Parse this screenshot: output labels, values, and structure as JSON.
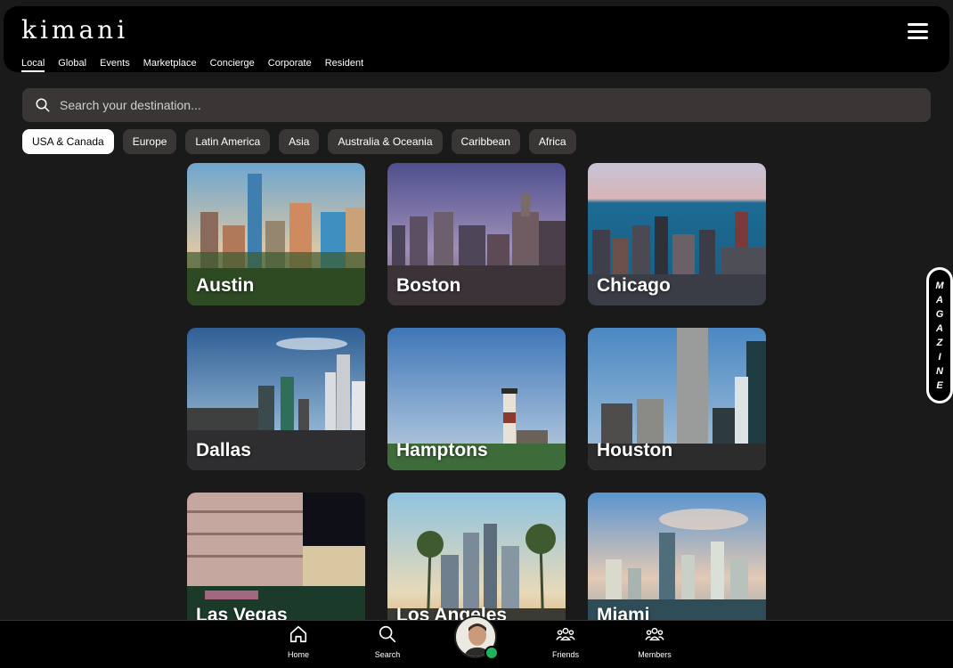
{
  "app": {
    "logo": "kimani"
  },
  "nav": {
    "tabs": [
      {
        "label": "Local",
        "active": true
      },
      {
        "label": "Global"
      },
      {
        "label": "Events"
      },
      {
        "label": "Marketplace"
      },
      {
        "label": "Concierge"
      },
      {
        "label": "Corporate"
      },
      {
        "label": "Resident"
      }
    ]
  },
  "search": {
    "placeholder": "Search your destination...",
    "value": ""
  },
  "regions": [
    {
      "label": "USA & Canada",
      "active": true
    },
    {
      "label": "Europe"
    },
    {
      "label": "Latin America"
    },
    {
      "label": "Asia"
    },
    {
      "label": "Australia & Oceania"
    },
    {
      "label": "Caribbean"
    },
    {
      "label": "Africa"
    }
  ],
  "cities": [
    {
      "name": "Austin"
    },
    {
      "name": "Boston"
    },
    {
      "name": "Chicago"
    },
    {
      "name": "Dallas"
    },
    {
      "name": "Hamptons"
    },
    {
      "name": "Houston"
    },
    {
      "name": "Las Vegas"
    },
    {
      "name": "Los Angeles"
    },
    {
      "name": "Miami"
    }
  ],
  "magazine": {
    "letters": [
      "M",
      "A",
      "G",
      "A",
      "Z",
      "I",
      "N",
      "E"
    ]
  },
  "bottom_nav": {
    "home": "Home",
    "search": "Search",
    "friends": "Friends",
    "members": "Members"
  },
  "colors": {
    "background": "#1a1a1a",
    "chip_bg": "#3b3636",
    "online": "#22b35a"
  },
  "icons": [
    "menu-icon",
    "search-icon",
    "home-icon",
    "friends-icon",
    "members-icon"
  ]
}
